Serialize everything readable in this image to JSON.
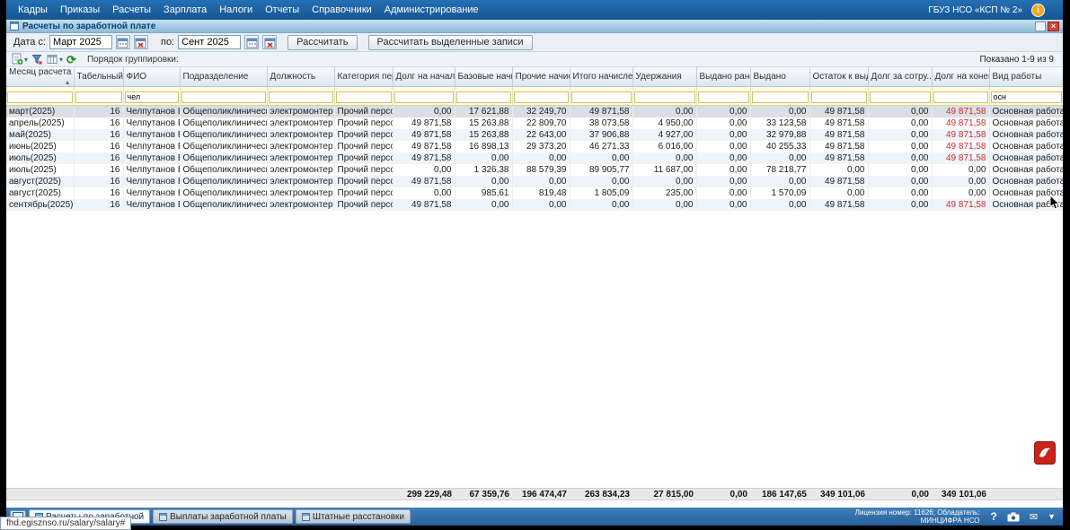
{
  "menu_bar": {
    "items": [
      "Кадры",
      "Приказы",
      "Расчеты",
      "Зарплата",
      "Налоги",
      "Отчеты",
      "Справочники",
      "Администрирование"
    ],
    "organization": "ГБУЗ НСО «КСП № 2»"
  },
  "window": {
    "title": "Расчеты по заработной плате"
  },
  "toolbar": {
    "date_from_label": "Дата с:",
    "date_from_value": "Март 2025",
    "date_to_label": "по:",
    "date_to_value": "Сент 2025",
    "calculate_button": "Рассчитать",
    "calculate_selected_button": "Рассчитать выделенные записи"
  },
  "grid_toolbar": {
    "grouping_label": "Порядок группировки:",
    "records_shown": "Показано 1-9 из 9"
  },
  "table": {
    "columns": [
      "Месяц расчета",
      "Табельный но...",
      "ФИО",
      "Подразделение",
      "Должность",
      "Категория пер...",
      "Долг на начал...",
      "Базовые начис...",
      "Прочие начис...",
      "Итого начисле...",
      "Удержания",
      "Выдано ранее",
      "Выдано",
      "Остаток к выд...",
      "Долг за сотру...",
      "Долг на конец...",
      "Вид работы"
    ],
    "filters": [
      "",
      "",
      "чел",
      "",
      "",
      "",
      "",
      "",
      "",
      "",
      "",
      "",
      "",
      "",
      "",
      "",
      "осн"
    ],
    "rows": [
      [
        "март(2025)",
        "16",
        "Челпутанов Евге...",
        "Общеполиклинический немед...",
        "электромонтер п...",
        "Прочий персонал",
        "0,00",
        "17 621,88",
        "32 249,70",
        "49 871,58",
        "0,00",
        "0,00",
        "0,00",
        "49 871,58",
        "0,00",
        "49 871,58",
        "Основная работа"
      ],
      [
        "апрель(2025)",
        "16",
        "Челпутанов Евге...",
        "Общеполиклинический немед...",
        "электромонтер п...",
        "Прочий персонал",
        "49 871,58",
        "15 263,88",
        "22 809,70",
        "38 073,58",
        "4 950,00",
        "0,00",
        "33 123,58",
        "49 871,58",
        "0,00",
        "49 871,58",
        "Основная работа"
      ],
      [
        "май(2025)",
        "16",
        "Челпутанов Евге...",
        "Общеполиклинический немед...",
        "электромонтер п...",
        "Прочий персонал",
        "49 871,58",
        "15 263,88",
        "22 643,00",
        "37 906,88",
        "4 927,00",
        "0,00",
        "32 979,88",
        "49 871,58",
        "0,00",
        "49 871,58",
        "Основная работа"
      ],
      [
        "июнь(2025)",
        "16",
        "Челпутанов Евге...",
        "Общеполиклинический немед...",
        "электромонтер п...",
        "Прочий персонал",
        "49 871,58",
        "16 898,13",
        "29 373,20",
        "46 271,33",
        "6 016,00",
        "0,00",
        "40 255,33",
        "49 871,58",
        "0,00",
        "49 871,58",
        "Основная работа"
      ],
      [
        "июль(2025)",
        "16",
        "Челпутанов Евге...",
        "Общеполиклинический немед...",
        "электромонтер п...",
        "Прочий персонал",
        "49 871,58",
        "0,00",
        "0,00",
        "0,00",
        "0,00",
        "0,00",
        "0,00",
        "49 871,58",
        "0,00",
        "49 871,58",
        "Основная работа"
      ],
      [
        "июль(2025)",
        "16",
        "Челпутанов Евге...",
        "Общеполиклинический немед...",
        "электромонтер п...",
        "Прочий персонал",
        "0,00",
        "1 326,38",
        "88 579,39",
        "89 905,77",
        "11 687,00",
        "0,00",
        "78 218,77",
        "0,00",
        "0,00",
        "0,00",
        "Основная работа"
      ],
      [
        "август(2025)",
        "16",
        "Челпутанов Евге...",
        "Общеполиклинический немед...",
        "электромонтер п...",
        "Прочий персонал",
        "49 871,58",
        "0,00",
        "0,00",
        "0,00",
        "0,00",
        "0,00",
        "0,00",
        "49 871,58",
        "0,00",
        "0,00",
        "Основная работа"
      ],
      [
        "август(2025)",
        "16",
        "Челпутанов Евге...",
        "Общеполиклинический немед...",
        "электромонтер п...",
        "Прочий персонал",
        "0,00",
        "985,61",
        "819,48",
        "1 805,09",
        "235,00",
        "0,00",
        "1 570,09",
        "0,00",
        "0,00",
        "0,00",
        "Основная работа"
      ],
      [
        "сентябрь(2025)",
        "16",
        "Челпутанов Евге...",
        "Общеполиклинический немед...",
        "электромонтер п...",
        "Прочий персонал",
        "49 871,58",
        "0,00",
        "0,00",
        "0,00",
        "0,00",
        "0,00",
        "0,00",
        "49 871,58",
        "0,00",
        "49 871,58",
        "Основная работа"
      ]
    ],
    "totals": [
      "",
      "",
      "",
      "",
      "",
      "",
      "299 229,48",
      "67 359,76",
      "196 474,47",
      "263 834,23",
      "27 815,00",
      "0,00",
      "186 147,65",
      "349 101,06",
      "0,00",
      "349 101,06",
      ""
    ]
  },
  "taskbar": {
    "tabs": [
      {
        "label": "Расчеты по заработной",
        "active": true
      },
      {
        "label": "Выплаты заработной платы",
        "active": false
      },
      {
        "label": "Штатные расстановки",
        "active": false
      }
    ],
    "license_line1": "Лицензия номер: 11626; Обладатель:",
    "license_line2": "МИНЦИФРА НСО"
  },
  "status_tooltip": "fhd.egisznso.ru/salary/salary#",
  "icons": {
    "info": "i",
    "close": "×",
    "sort_asc": "▲",
    "dropdown": "▾",
    "refresh": "⟳",
    "help": "?",
    "mail": "✉",
    "collapse": "▼"
  },
  "colors": {
    "menu_bg": "#1c64a9",
    "negative_value": "#d42a2a",
    "filter_row_bg": "#fcfbe2",
    "red_widget": "#c8231d"
  }
}
